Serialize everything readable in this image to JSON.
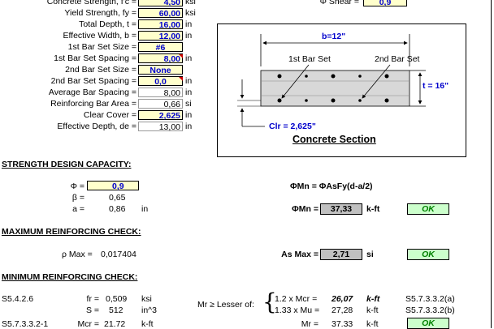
{
  "inputs": [
    {
      "label": "Concrete Strength, f'c =",
      "value": "4,50",
      "unit": "ksi",
      "style": "yel"
    },
    {
      "label": "Yield Strength, fy =",
      "value": "60,00",
      "unit": "ksi",
      "style": "yel"
    },
    {
      "label": "Total Depth, t =",
      "value": "16,00",
      "unit": "in",
      "style": "yel"
    },
    {
      "label": "Effective Width, b =",
      "value": "12,00",
      "unit": "in",
      "style": "yel"
    },
    {
      "label": "1st Bar Set Size =",
      "value": "#6",
      "unit": "",
      "style": "yelc"
    },
    {
      "label": "1st Bar Set Spacing =",
      "value": "8,00",
      "unit": "in",
      "style": "yel"
    },
    {
      "label": "2nd Bar Set Size =",
      "value": "None",
      "unit": "",
      "style": "yelc"
    },
    {
      "label": "2nd Bar Set Spacing =",
      "value": "0,0",
      "unit": "in",
      "style": "yelc"
    },
    {
      "label": "Average Bar Spacing =",
      "value": "8,00",
      "unit": "in",
      "style": "wht"
    },
    {
      "label": "Reinforcing Bar Area =",
      "value": "0,66",
      "unit": "si",
      "style": "wht"
    },
    {
      "label": "Clear Cover =",
      "value": "2,625",
      "unit": "in",
      "style": "yel"
    },
    {
      "label": "Effective Depth, de =",
      "value": "13,00",
      "unit": "in",
      "style": "wht"
    }
  ],
  "phi_shear": {
    "label": "Φ Shear =",
    "value": "0,9"
  },
  "diagram": {
    "width_label": "b=12\"",
    "bar1_label": "1st Bar Set",
    "bar2_label": "2nd Bar Set",
    "depth_label": "t = 16\"",
    "clr_label": "Clr = 2,625\"",
    "title": "Concrete Section"
  },
  "strength": {
    "header": "STRENGTH DESIGN CAPACITY:",
    "phi_label": "Φ =",
    "phi_value": "0,9",
    "beta_label": "β =",
    "beta_value": "0,65",
    "a_label": "a =",
    "a_value": "0,86",
    "a_unit": "in",
    "formula": "ΦMn = ΦAsFy(d-a/2)",
    "mn_label": "ΦMn =",
    "mn_value": "37,33",
    "mn_unit": "k-ft",
    "mn_status": "OK"
  },
  "maximum": {
    "header": "MAXIMUM REINFORCING CHECK:",
    "rho_label": "ρ Max =",
    "rho_value": "0,017404",
    "as_label": "As Max =",
    "as_value": "2,71",
    "as_unit": "si",
    "as_status": "OK"
  },
  "minimum": {
    "header": "MINIMUM REINFORCING CHECK:",
    "ref1": "S5.4.2.6",
    "fr_label": "fr =",
    "fr_value": "0,509",
    "fr_unit": "ksi",
    "s_label": "S =",
    "s_value": "512",
    "s_unit": "in^3",
    "ref2": "S5.7.3.3.2-1",
    "mcr_label": "Mcr =",
    "mcr_value": "21.72",
    "mcr_unit": "k-ft",
    "lesser_label": "Mr ≥ Lesser of:",
    "opt1_label": "1.2 x Mcr =",
    "opt1_value": "26,07",
    "opt1_unit": "k-ft",
    "opt1_ref": "S5.7.3.3.2(a)",
    "opt2_label": "1.33 x Mu =",
    "opt2_value": "27,28",
    "opt2_unit": "k-ft",
    "opt2_ref": "S5.7.3.3.2(b)",
    "mr_label": "Mr =",
    "mr_value": "37.33",
    "mr_unit": "k-ft",
    "mr_status": "OK"
  }
}
